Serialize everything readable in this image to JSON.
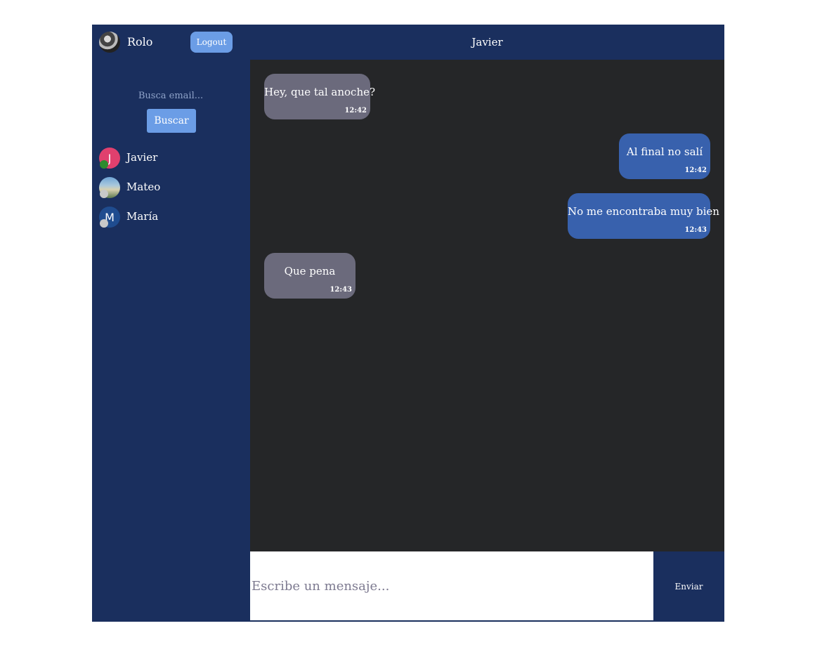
{
  "user": {
    "name": "Rolo",
    "logout_label": "Logout"
  },
  "search": {
    "placeholder": "Busca email...",
    "button_label": "Buscar"
  },
  "contacts": [
    {
      "name": "Javier",
      "initial": "J",
      "avatar_color": "#e0406e",
      "online": true
    },
    {
      "name": "Mateo",
      "initial": "",
      "avatar_color": "#8fb3c9",
      "online": false
    },
    {
      "name": "María",
      "initial": "M",
      "avatar_color": "#1f4c8f",
      "online": false
    }
  ],
  "chat": {
    "title": "Javier",
    "messages": [
      {
        "text": "Hey, que tal anoche?",
        "time": "12:42",
        "direction": "received"
      },
      {
        "text": "Al final no salí",
        "time": "12:42",
        "direction": "sent"
      },
      {
        "text": "No me encontraba muy bien",
        "time": "12:43",
        "direction": "sent"
      },
      {
        "text": "Que pena",
        "time": "12:43",
        "direction": "received"
      }
    ]
  },
  "composer": {
    "placeholder": "Escribe un mensaje...",
    "send_label": "Enviar"
  },
  "colors": {
    "panel": "#1a2f5e",
    "messages_bg": "#252628",
    "received_bubble": "#6b6a7c",
    "sent_bubble": "#3861ad",
    "accent_button": "#6b9de6",
    "online_dot": "#2e8b2e",
    "offline_dot": "#c8c8c8"
  }
}
